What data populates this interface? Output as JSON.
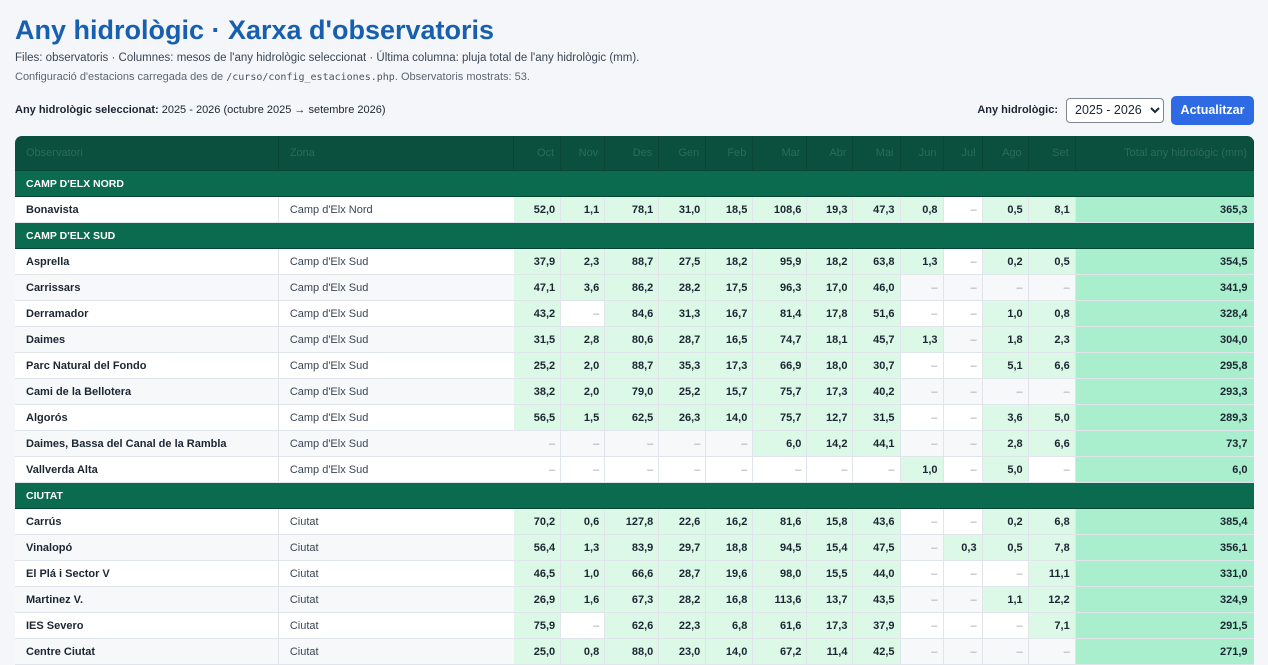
{
  "page": {
    "title": "Any hidrològic · Xarxa d'observatoris",
    "subtitle": "Files: observatoris · Columnes: mesos de l'any hidrològic seleccionat · Última columna: pluja total de l'any hidrològic (mm).",
    "config_prefix": "Configuració d'estacions carregada des de",
    "config_path": "/curso/config_estaciones.php",
    "config_suffix": ". Observatoris mostrats: 53."
  },
  "toolbar": {
    "selected_label": "Any hidrològic seleccionat:",
    "selected_value": "2025 - 2026 (octubre 2025 → setembre 2026)",
    "select_label": "Any hidrològic:",
    "select_value": "2025 - 2026",
    "button_label": "Actualitzar"
  },
  "table": {
    "headers": [
      "Observatori",
      "Zona",
      "Oct",
      "Nov",
      "Des",
      "Gen",
      "Feb",
      "Mar",
      "Abr",
      "Mai",
      "Jun",
      "Jul",
      "Ago",
      "Set",
      "Total any hidrològic (mm)"
    ],
    "groups": [
      {
        "zone": "CAMP D'ELX NORD",
        "rows": [
          {
            "name": "Bonavista",
            "zona": "Camp d'Elx Nord",
            "months": [
              "52,0",
              "1,1",
              "78,1",
              "31,0",
              "18,5",
              "108,6",
              "19,3",
              "47,3",
              "0,8",
              "–",
              "0,5",
              "8,1"
            ],
            "total": "365,3"
          }
        ]
      },
      {
        "zone": "CAMP D'ELX SUD",
        "rows": [
          {
            "name": "Asprella",
            "zona": "Camp d'Elx Sud",
            "months": [
              "37,9",
              "2,3",
              "88,7",
              "27,5",
              "18,2",
              "95,9",
              "18,2",
              "63,8",
              "1,3",
              "–",
              "0,2",
              "0,5"
            ],
            "total": "354,5"
          },
          {
            "name": "Carrissars",
            "zona": "Camp d'Elx Sud",
            "months": [
              "47,1",
              "3,6",
              "86,2",
              "28,2",
              "17,5",
              "96,3",
              "17,0",
              "46,0",
              "–",
              "–",
              "–",
              "–"
            ],
            "total": "341,9"
          },
          {
            "name": "Derramador",
            "zona": "Camp d'Elx Sud",
            "months": [
              "43,2",
              "–",
              "84,6",
              "31,3",
              "16,7",
              "81,4",
              "17,8",
              "51,6",
              "–",
              "–",
              "1,0",
              "0,8"
            ],
            "total": "328,4"
          },
          {
            "name": "Daimes",
            "zona": "Camp d'Elx Sud",
            "months": [
              "31,5",
              "2,8",
              "80,6",
              "28,7",
              "16,5",
              "74,7",
              "18,1",
              "45,7",
              "1,3",
              "–",
              "1,8",
              "2,3"
            ],
            "total": "304,0"
          },
          {
            "name": "Parc Natural del Fondo",
            "zona": "Camp d'Elx Sud",
            "months": [
              "25,2",
              "2,0",
              "88,7",
              "35,3",
              "17,3",
              "66,9",
              "18,0",
              "30,7",
              "–",
              "–",
              "5,1",
              "6,6"
            ],
            "total": "295,8"
          },
          {
            "name": "Cami de la Bellotera",
            "zona": "Camp d'Elx Sud",
            "months": [
              "38,2",
              "2,0",
              "79,0",
              "25,2",
              "15,7",
              "75,7",
              "17,3",
              "40,2",
              "–",
              "–",
              "–",
              "–"
            ],
            "total": "293,3"
          },
          {
            "name": "Algorós",
            "zona": "Camp d'Elx Sud",
            "months": [
              "56,5",
              "1,5",
              "62,5",
              "26,3",
              "14,0",
              "75,7",
              "12,7",
              "31,5",
              "–",
              "–",
              "3,6",
              "5,0"
            ],
            "total": "289,3"
          },
          {
            "name": "Daimes, Bassa del Canal de la Rambla",
            "zona": "Camp d'Elx Sud",
            "months": [
              "–",
              "–",
              "–",
              "–",
              "–",
              "6,0",
              "14,2",
              "44,1",
              "–",
              "–",
              "2,8",
              "6,6"
            ],
            "total": "73,7"
          },
          {
            "name": "Vallverda Alta",
            "zona": "Camp d'Elx Sud",
            "months": [
              "–",
              "–",
              "–",
              "–",
              "–",
              "–",
              "–",
              "–",
              "1,0",
              "–",
              "5,0",
              "–"
            ],
            "total": "6,0"
          }
        ]
      },
      {
        "zone": "CIUTAT",
        "rows": [
          {
            "name": "Carrús",
            "zona": "Ciutat",
            "months": [
              "70,2",
              "0,6",
              "127,8",
              "22,6",
              "16,2",
              "81,6",
              "15,8",
              "43,6",
              "–",
              "–",
              "0,2",
              "6,8"
            ],
            "total": "385,4"
          },
          {
            "name": "Vinalopó",
            "zona": "Ciutat",
            "months": [
              "56,4",
              "1,3",
              "83,9",
              "29,7",
              "18,8",
              "94,5",
              "15,4",
              "47,5",
              "–",
              "0,3",
              "0,5",
              "7,8"
            ],
            "total": "356,1"
          },
          {
            "name": "El Plá i Sector V",
            "zona": "Ciutat",
            "months": [
              "46,5",
              "1,0",
              "66,6",
              "28,7",
              "19,6",
              "98,0",
              "15,5",
              "44,0",
              "–",
              "–",
              "–",
              "11,1"
            ],
            "total": "331,0"
          },
          {
            "name": "Martinez V.",
            "zona": "Ciutat",
            "months": [
              "26,9",
              "1,6",
              "67,3",
              "28,2",
              "16,8",
              "113,6",
              "13,7",
              "43,5",
              "–",
              "–",
              "1,1",
              "12,2"
            ],
            "total": "324,9"
          },
          {
            "name": "IES Severo",
            "zona": "Ciutat",
            "months": [
              "75,9",
              "–",
              "62,6",
              "22,3",
              "6,8",
              "61,6",
              "17,3",
              "37,9",
              "–",
              "–",
              "–",
              "7,1"
            ],
            "total": "291,5"
          },
          {
            "name": "Centre Ciutat",
            "zona": "Ciutat",
            "months": [
              "25,0",
              "0,8",
              "88,0",
              "23,0",
              "14,0",
              "67,2",
              "11,4",
              "42,5",
              "–",
              "–",
              "–",
              "–"
            ],
            "total": "271,9"
          }
        ]
      }
    ]
  },
  "colors": {
    "title": "#1760b0",
    "header_bg": "#0b4f3e",
    "zone_bg": "#0b6b4f",
    "value_bg": "#dcf8e7",
    "total_bg": "#a9efcd",
    "button_bg": "#2d6ae3"
  }
}
